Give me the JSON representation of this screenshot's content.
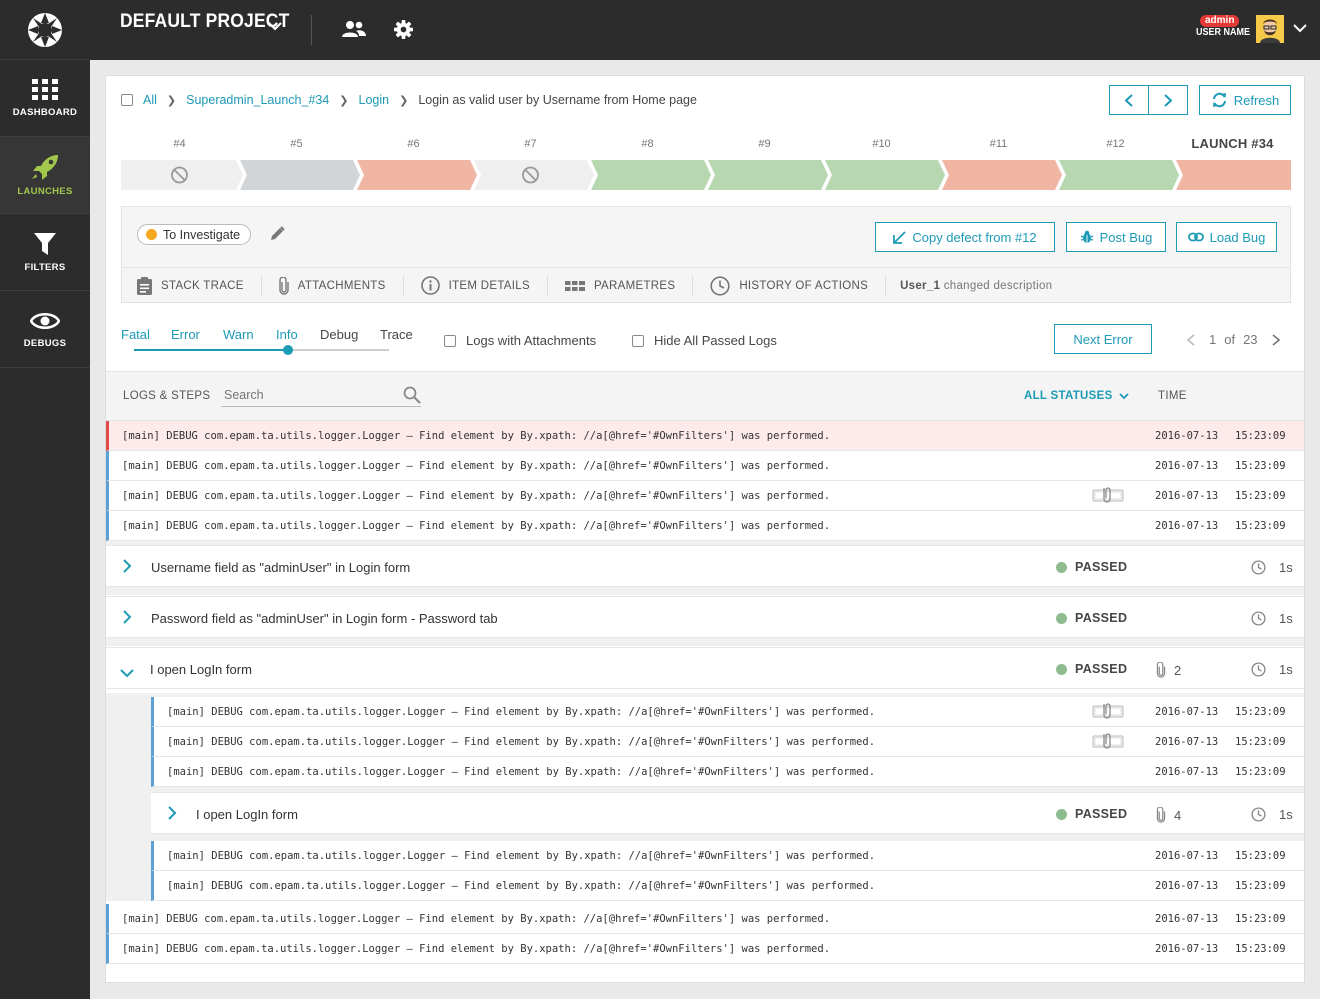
{
  "sidebar": {
    "items": [
      {
        "label": "DASHBOARD",
        "icon": "dashboard-icon"
      },
      {
        "label": "LAUNCHES",
        "icon": "rocket-icon",
        "active": true
      },
      {
        "label": "FILTERS",
        "icon": "filter-icon"
      },
      {
        "label": "DEBUGS",
        "icon": "eye-icon"
      }
    ]
  },
  "header": {
    "project": "DEFAULT PROJECT",
    "user": {
      "role": "admin",
      "name": "USER NAME"
    }
  },
  "breadcrumb": {
    "all": "All",
    "launch": "Superadmin_Launch_#34",
    "suite": "Login",
    "current": "Login as valid user by Username from Home page"
  },
  "toolbar": {
    "refresh": "Refresh"
  },
  "history": {
    "items": [
      {
        "label": "#4",
        "status": "skipped"
      },
      {
        "label": "#5",
        "status": "interrupted"
      },
      {
        "label": "#6",
        "status": "failed"
      },
      {
        "label": "#7",
        "status": "skipped"
      },
      {
        "label": "#8",
        "status": "passed"
      },
      {
        "label": "#9",
        "status": "passed"
      },
      {
        "label": "#10",
        "status": "passed"
      },
      {
        "label": "#11",
        "status": "failed"
      },
      {
        "label": "#12",
        "status": "passed"
      },
      {
        "label": "LAUNCH #34",
        "status": "failed",
        "current": true
      }
    ]
  },
  "defect": {
    "type": "To Investigate",
    "copy_label": "Copy defect from #12",
    "post_bug": "Post Bug",
    "load_bug": "Load Bug"
  },
  "tabs": [
    {
      "label": "STACK TRACE",
      "icon": "clipboard-icon"
    },
    {
      "label": "ATTACHMENTS",
      "icon": "paperclip-icon"
    },
    {
      "label": "ITEM DETAILS",
      "icon": "info-icon"
    },
    {
      "label": "PARAMETRES",
      "icon": "table-icon"
    },
    {
      "label": "HISTORY OF ACTIONS",
      "icon": "clock-icon"
    }
  ],
  "last_action": {
    "user": "User_1",
    "text": "changed description"
  },
  "log_levels": {
    "items": [
      "Fatal",
      "Error",
      "Warn",
      "Info",
      "Debug",
      "Trace"
    ],
    "selected_index": 3
  },
  "filters": {
    "with_attachments": "Logs with Attachments",
    "hide_passed": "Hide All Passed Logs"
  },
  "pagination": {
    "next_error": "Next Error",
    "current": "1",
    "of": "of",
    "total": "23"
  },
  "table": {
    "title": "LOGS & STEPS",
    "search_placeholder": "Search",
    "status_filter": "ALL STATUSES",
    "time_header": "TIME"
  },
  "log_message": "[main] DEBUG com.epam.ta.utils.logger.Logger – Find element by By.xpath: //a[@href='#OwnFilters'] was performed.",
  "log_date": "2016-07-13",
  "log_time": "15:23:09",
  "steps": [
    {
      "name": "Username field as \"adminUser\" in Login form",
      "status": "PASSED",
      "duration": "1s"
    },
    {
      "name": "Password field as \"adminUser\" in Login form - Password tab",
      "status": "PASSED",
      "duration": "1s"
    },
    {
      "name": "I open LogIn form",
      "status": "PASSED",
      "attachments": "2",
      "duration": "1s"
    },
    {
      "name": "I open LogIn form",
      "status": "PASSED",
      "attachments": "4",
      "duration": "1s"
    }
  ],
  "colors": {
    "accent": "#1d9ab5",
    "passed": "#b7d7b1",
    "failed": "#f0b5a3",
    "interrupted": "#d1d5d8",
    "skipped": "#efefef",
    "to_investigate": "#f6a821",
    "error_row": "#fdeaea"
  }
}
